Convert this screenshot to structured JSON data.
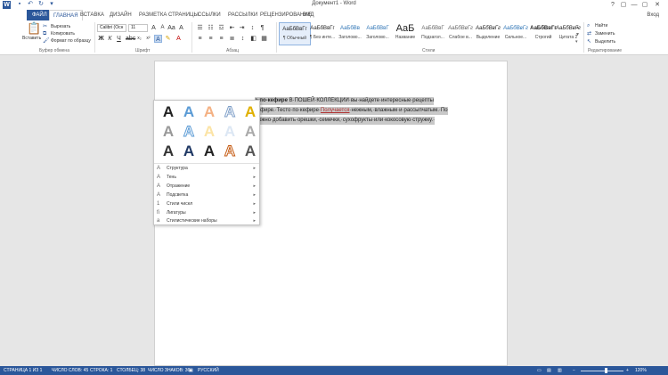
{
  "window": {
    "app_icon": "W",
    "title": "Документ1 - Word",
    "buttons": [
      "?",
      "▢",
      "—",
      "▢",
      "✕"
    ]
  },
  "quick_access": [
    "save-icon",
    "undo-icon",
    "redo-icon"
  ],
  "tabs": {
    "file": "ФАЙЛ",
    "items": [
      "ГЛАВНАЯ",
      "ВСТАВКА",
      "ДИЗАЙН",
      "РАЗМЕТКА СТРАНИЦЫ",
      "ССЫЛКИ",
      "РАССЫЛКИ",
      "РЕЦЕНЗИРОВАНИЕ",
      "ВИД"
    ],
    "active": "ГЛАВНАЯ",
    "signin": "Вход"
  },
  "ribbon": {
    "clipboard": {
      "paste": "Вставить",
      "cut": "Вырезать",
      "copy": "Копировать",
      "format_painter": "Формат по образцу",
      "label": "Буфер обмена"
    },
    "font": {
      "name": "Calibri (Осн",
      "size": "11",
      "label": "Шрифт"
    },
    "paragraph": {
      "label": "Абзац"
    },
    "styles": {
      "label": "Стили",
      "items": [
        {
          "preview": "АаБбВвГг",
          "name": "¶ Обычный"
        },
        {
          "preview": "АаБбВвГг",
          "name": "¶ Без инте..."
        },
        {
          "preview": "АаБбВв",
          "name": "Заголово..."
        },
        {
          "preview": "АаБбВвГ",
          "name": "Заголово..."
        },
        {
          "preview": "АаБ",
          "name": "Название"
        },
        {
          "preview": "АаБбВвГ",
          "name": "Подзагол..."
        },
        {
          "preview": "АаБбВвГг",
          "name": "Слабое в..."
        },
        {
          "preview": "АаБбВвГг",
          "name": "Выделение"
        },
        {
          "preview": "АаБбВвГг",
          "name": "Сильное..."
        },
        {
          "preview": "АаБбВвГг",
          "name": "Строгий"
        },
        {
          "preview": "АаБбВвГг",
          "name": "Цитата 2"
        }
      ]
    },
    "editing": {
      "find": "Найти",
      "replace": "Заменить",
      "select": "Выделить",
      "label": "Редактирование"
    }
  },
  "document": {
    "line1_bold": "a-по-кефире",
    "line1_rest": " В·ПОШЕЙ·КОЛЛЕКЦИИ·вы·найдете·интересные·рецепты",
    "line2_a": "кефире.·Тесто·по·кефире·",
    "line2_und": "Получается",
    "line2_b": "·нежным,·влажным·и·рассыпчатым.·По",
    "line3": "можно·добавить·орешки,·семечки,·сухофрукты·или·кокосовую·стружку.·"
  },
  "text_effects_menu": {
    "effects_glyph": "A",
    "items": [
      {
        "icon": "outline-icon",
        "label": "Структура"
      },
      {
        "icon": "shadow-icon",
        "label": "Тень"
      },
      {
        "icon": "reflection-icon",
        "label": "Отражение"
      },
      {
        "icon": "glow-icon",
        "label": "Подсветка"
      },
      {
        "icon": "number-style-icon",
        "label": "Стили чисел"
      },
      {
        "icon": "ligature-icon",
        "label": "Лигатуры"
      },
      {
        "icon": "stylistic-set-icon",
        "label": "Стилистические наборы"
      }
    ]
  },
  "statusbar": {
    "page": "СТРАНИЦА 1 ИЗ 1",
    "words": "ЧИСЛО СЛОВ: 45",
    "line": "СТРОКА: 1",
    "column": "СТОЛБЕЦ: 38",
    "chars": "ЧИСЛО ЗНАКОВ: 36",
    "language": "РУССКИЙ",
    "zoom": "120%"
  },
  "colors": {
    "word_blue": "#2b579a",
    "selection_gray": "#c8c8c8"
  }
}
